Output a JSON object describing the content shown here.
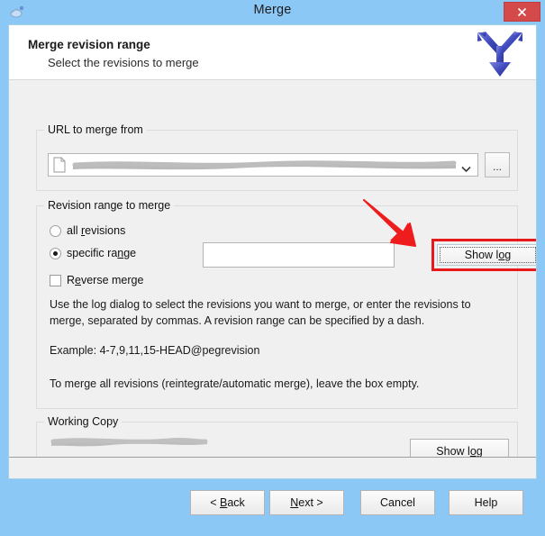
{
  "window": {
    "title": "Merge",
    "app_icon": "merge-app-icon",
    "close_label": "×",
    "close_color": "#d44a4a",
    "titlebar_color": "#8cc8f5"
  },
  "wizard_header": {
    "title": "Merge revision range",
    "subtitle": "Select the revisions to merge",
    "logo_icon": "merge-arrow-logo",
    "logo_color": "#4a55c8"
  },
  "url_group": {
    "legend": "URL to merge from",
    "combo": {
      "icon": "file-icon",
      "value": "",
      "redacted": true,
      "caret_icon": "chevron-down-icon"
    },
    "browse_label": "..."
  },
  "revision_group": {
    "legend": "Revision range to merge",
    "options": [
      {
        "label": "all revisions",
        "accel": "r",
        "checked": false,
        "name": "all-revisions"
      },
      {
        "label": "specific range",
        "accel": "n",
        "checked": true,
        "name": "specific-range"
      }
    ],
    "reverse_merge": {
      "label": "Reverse merge",
      "accel": "e",
      "checked": false
    },
    "range_input": {
      "value": "",
      "placeholder": ""
    },
    "show_log_label": "Show log",
    "show_log_accel": "o",
    "highlight_color": "#e8191b",
    "annotation_arrow": {
      "icon": "red-arrow-annotation",
      "color": "#ee1c1c"
    },
    "description": [
      "Use the log dialog to select the revisions you want to merge, or enter the revisions to merge, separated by commas. A revision range can be specified by a dash.",
      "Example: 4-7,9,11,15-HEAD@pegrevision",
      "To merge all revisions (reintegrate/automatic merge), leave the box empty."
    ]
  },
  "working_copy_group": {
    "legend": "Working Copy",
    "path": "",
    "redacted": true,
    "show_log_label": "Show log"
  },
  "footer": {
    "buttons": [
      {
        "label": "< Back",
        "accel": "B",
        "name": "back-button"
      },
      {
        "label": "Next >",
        "accel": "N",
        "name": "next-button"
      },
      {
        "label": "Cancel",
        "accel": "",
        "name": "cancel-button"
      },
      {
        "label": "Help",
        "accel": "",
        "name": "help-button"
      }
    ]
  }
}
